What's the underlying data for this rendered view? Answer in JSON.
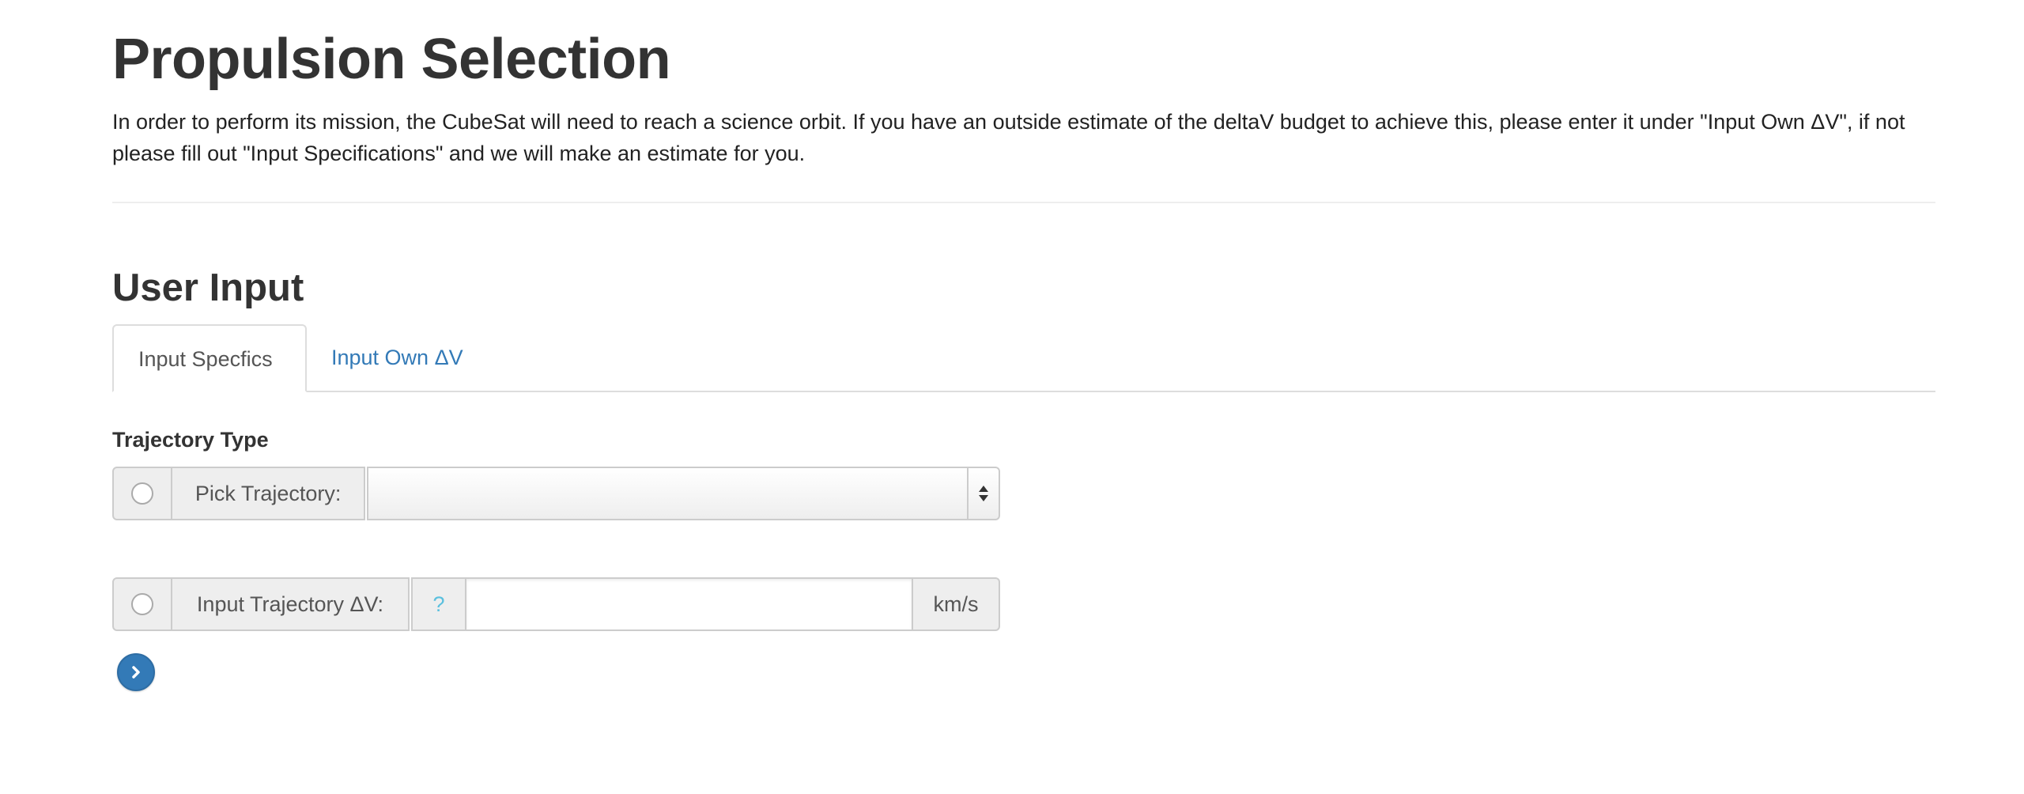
{
  "page": {
    "title": "Propulsion Selection",
    "intro": "In order to perform its mission, the CubeSat will need to reach a science orbit. If you have an outside estimate of the deltaV budget to achieve this, please enter it under \"Input Own ΔV\", if not please fill out \"Input Specifications\" and we will make an estimate for you."
  },
  "user_input": {
    "title": "User Input",
    "tabs": [
      {
        "label": "Input Specfics",
        "active": true
      },
      {
        "label": "Input Own ΔV",
        "active": false
      }
    ],
    "trajectory_type_label": "Trajectory Type",
    "pick_trajectory": {
      "label": "Pick Trajectory:",
      "selected_value": ""
    },
    "input_trajectory": {
      "label": "Input Trajectory ΔV:",
      "help": "?",
      "value": "",
      "unit": "km/s"
    },
    "next_icon": "chevron-right-icon"
  },
  "colors": {
    "link": "#337ab7",
    "help": "#5bc0de",
    "button": "#337ab7"
  }
}
